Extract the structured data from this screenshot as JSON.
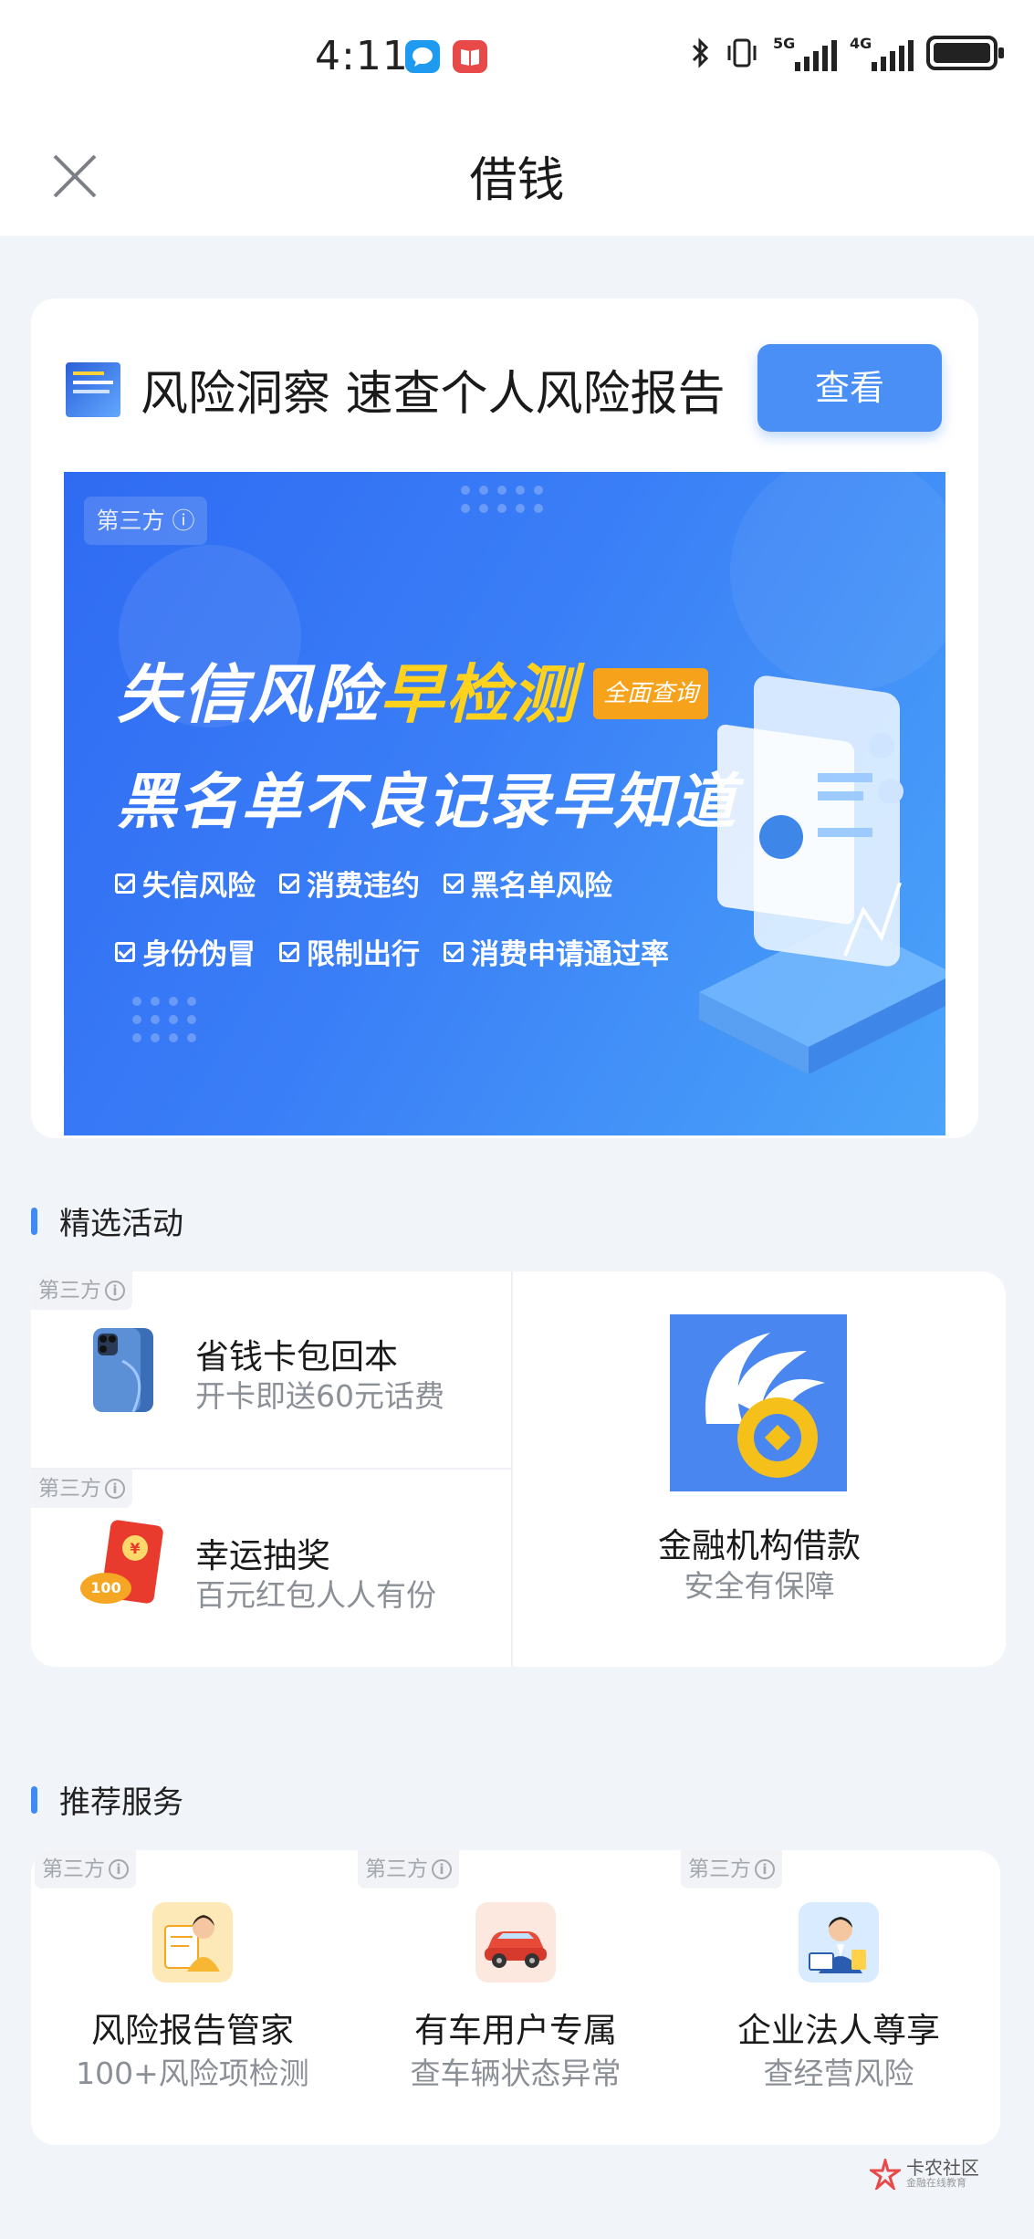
{
  "status_bar": {
    "time": "4:11",
    "icons": [
      "chat-bubble-icon",
      "book-app-icon",
      "bluetooth-icon",
      "vibrate-icon",
      "signal-5g-icon",
      "signal-4g-icon",
      "battery-icon"
    ],
    "network_labels": [
      "5G",
      "4G"
    ],
    "colors": {
      "chat_app": "#1e9bf0",
      "book_app": "#e84a4a"
    }
  },
  "nav": {
    "title": "借钱",
    "close_icon": "close-icon"
  },
  "risk_card": {
    "title": "风险洞察 速查个人风险报告",
    "button_label": "查看",
    "banner": {
      "badge": "第三方 ⓘ",
      "headline_prefix": "失信风险",
      "headline_highlight": "早检测",
      "tag": "全面查询",
      "subheadline": "黑名单不良记录早知道",
      "items": [
        "失信风险",
        "消费违约",
        "黑名单风险",
        "身份伪冒",
        "限制出行",
        "消费申请通过率"
      ]
    }
  },
  "activities": {
    "section_title": "精选活动",
    "badge": "第三方",
    "items": [
      {
        "title": "省钱卡包回本",
        "subtitle": "开卡即送60元话费",
        "icon": "phone-icon"
      },
      {
        "title": "幸运抽奖",
        "subtitle": "百元红包人人有份",
        "icon": "red-envelope-icon",
        "icon_text": "100"
      },
      {
        "title": "金融机构借款",
        "subtitle": "安全有保障",
        "icon": "finance-logo-icon"
      }
    ]
  },
  "services": {
    "section_title": "推荐服务",
    "badge": "第三方",
    "items": [
      {
        "title": "风险报告管家",
        "subtitle": "100+风险项检测",
        "icon": "report-manager-icon"
      },
      {
        "title": "有车用户专属",
        "subtitle": "查车辆状态异常",
        "icon": "car-icon"
      },
      {
        "title": "企业法人尊享",
        "subtitle": "查经营风险",
        "icon": "business-person-icon"
      }
    ]
  },
  "watermark": {
    "title": "卡农社区",
    "subtitle": "金融在线教育"
  },
  "colors": {
    "accent": "#4a8ff5",
    "highlight": "#ffd21e",
    "tag": "#f7a21b",
    "background": "#f1f4f9"
  }
}
